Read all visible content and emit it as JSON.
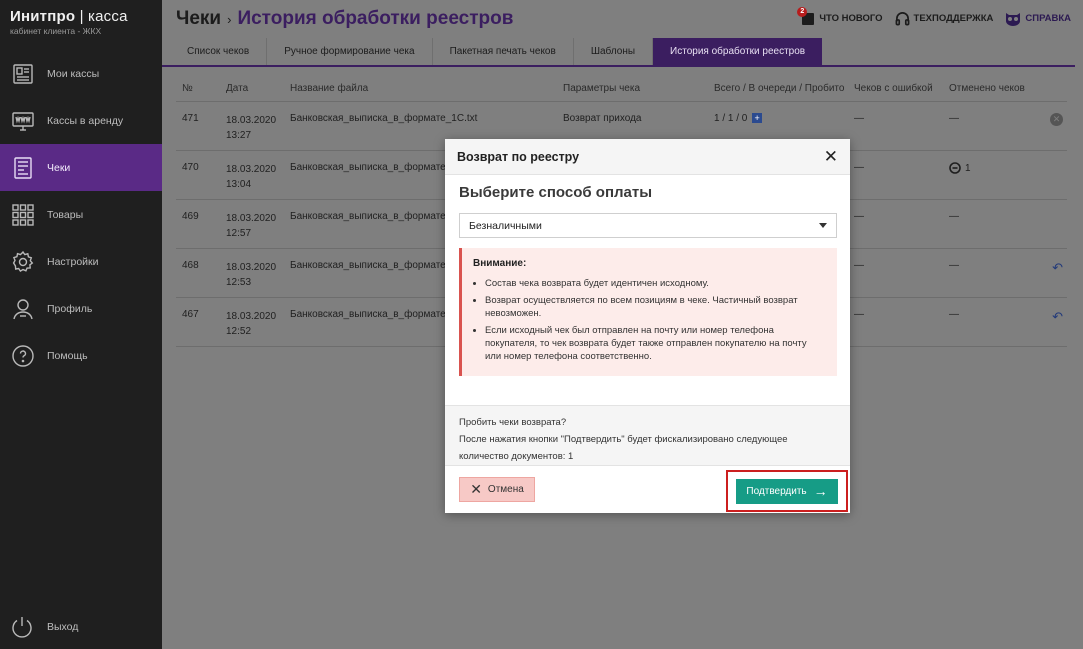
{
  "brand": {
    "name_bold": "Инитпро",
    "name_light": " | касса",
    "subtitle": "кабинет клиента - ЖКХ"
  },
  "sidebar": {
    "items": [
      {
        "label": "Мои кассы",
        "icon": "cash-register-icon"
      },
      {
        "label": "Кассы в аренду",
        "icon": "www-monitor-icon"
      },
      {
        "label": "Чеки",
        "icon": "receipt-icon",
        "active": true
      },
      {
        "label": "Товары",
        "icon": "grid-icon"
      },
      {
        "label": "Настройки",
        "icon": "gear-icon"
      },
      {
        "label": "Профиль",
        "icon": "user-icon"
      },
      {
        "label": "Помощь",
        "icon": "question-icon"
      }
    ],
    "logout": "Выход"
  },
  "header": {
    "title": "Чеки",
    "separator": "›",
    "subtitle": "История обработки реестров",
    "links": {
      "news": "ЧТО НОВОГО",
      "news_badge": "2",
      "support": "ТЕХПОДДЕРЖКА",
      "help": "СПРАВКА"
    }
  },
  "tabs": [
    {
      "label": "Список чеков"
    },
    {
      "label": "Ручное формирование чека"
    },
    {
      "label": "Пакетная печать чеков"
    },
    {
      "label": "Шаблоны"
    },
    {
      "label": "История обработки реестров",
      "active": true
    }
  ],
  "table": {
    "headers": {
      "no": "№",
      "date": "Дата",
      "file": "Название файла",
      "params": "Параметры чека",
      "total": "Всего / В очереди / Пробито",
      "err": "Чеков с ошибкой",
      "cancel": "Отменено чеков"
    },
    "rows": [
      {
        "no": "471",
        "date": "18.03.2020",
        "time": "13:27",
        "file": "Банковская_выписка_в_формате_1С.txt",
        "params": "Возврат прихода",
        "total": "1 / 1 / 0",
        "err": "—",
        "cancel": "—"
      },
      {
        "no": "470",
        "date": "18.03.2020",
        "time": "13:04",
        "file": "Банковская_выписка_в_формате",
        "params": "",
        "total": "",
        "err": "—",
        "cancel": "1"
      },
      {
        "no": "469",
        "date": "18.03.2020",
        "time": "12:57",
        "file": "Банковская_выписка_в_формате",
        "params": "",
        "total": "",
        "err": "—",
        "cancel": "—"
      },
      {
        "no": "468",
        "date": "18.03.2020",
        "time": "12:53",
        "file": "Банковская_выписка_в_формате",
        "params": "",
        "total": "",
        "err": "—",
        "cancel": "—"
      },
      {
        "no": "467",
        "date": "18.03.2020",
        "time": "12:52",
        "file": "Банковская_выписка_в_формате",
        "params": "",
        "total": "",
        "err": "—",
        "cancel": "—"
      }
    ]
  },
  "modal": {
    "title": "Возврат по реестру",
    "heading": "Выберите способ оплаты",
    "payment_selected": "Безналичными",
    "warning": {
      "title": "Внимание:",
      "items": [
        "Состав чека возврата будет идентичен исходному.",
        "Возврат осуществляется по всем позициям в чеке. Частичный возврат невозможен.",
        "Если исходный чек был отправлен на почту или номер телефона покупателя, то чек возврата будет также отправлен покупателю на почту или номер телефона соответственно."
      ]
    },
    "info": {
      "line1": "Пробить чеки возврата?",
      "line2": "После нажатия кнопки \"Подтвердить\" будет фискализировано следующее",
      "line3": "количество документов: 1"
    },
    "cancel_label": "Отмена",
    "confirm_label": "Подтвердить"
  }
}
